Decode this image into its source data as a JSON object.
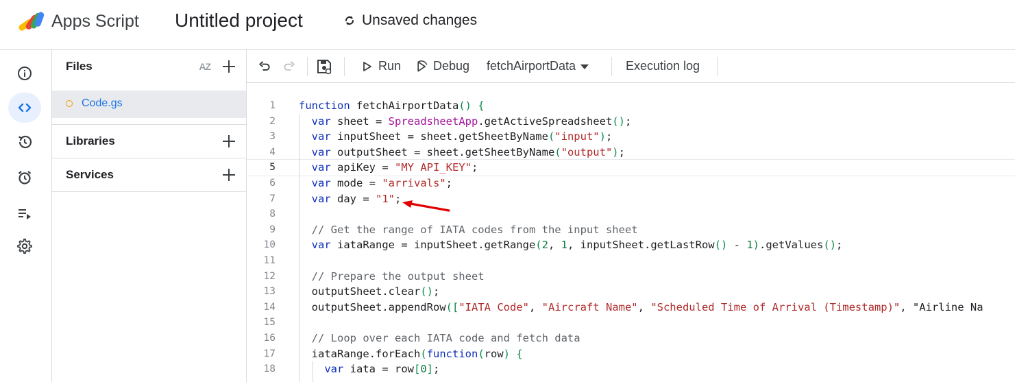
{
  "header": {
    "app_name": "Apps Script",
    "project_title": "Untitled project",
    "status": "Unsaved changes"
  },
  "rail": {
    "items": [
      {
        "name": "overview",
        "icon": "info-icon"
      },
      {
        "name": "editor",
        "icon": "code-icon",
        "active": true
      },
      {
        "name": "triggers-history",
        "icon": "history-icon"
      },
      {
        "name": "triggers",
        "icon": "alarm-icon"
      },
      {
        "name": "executions",
        "icon": "executions-icon"
      },
      {
        "name": "settings",
        "icon": "gear-icon"
      }
    ]
  },
  "files_panel": {
    "files_label": "Files",
    "sort_label": "AZ",
    "file_name": "Code.gs",
    "libraries_label": "Libraries",
    "services_label": "Services"
  },
  "toolbar": {
    "run_label": "Run",
    "debug_label": "Debug",
    "function_select": "fetchAirportData",
    "execution_log_label": "Execution log"
  },
  "editor": {
    "current_line": 5,
    "lines": [
      {
        "n": "1",
        "text": "function fetchAirportData() {"
      },
      {
        "n": "2",
        "text": "  var sheet = SpreadsheetApp.getActiveSpreadsheet();"
      },
      {
        "n": "3",
        "text": "  var inputSheet = sheet.getSheetByName(\"input\");"
      },
      {
        "n": "4",
        "text": "  var outputSheet = sheet.getSheetByName(\"output\");"
      },
      {
        "n": "5",
        "text": "  var apiKey = \"MY API_KEY\";"
      },
      {
        "n": "6",
        "text": "  var mode = \"arrivals\";"
      },
      {
        "n": "7",
        "text": "  var day = \"1\";"
      },
      {
        "n": "8",
        "text": ""
      },
      {
        "n": "9",
        "text": "  // Get the range of IATA codes from the input sheet"
      },
      {
        "n": "10",
        "text": "  var iataRange = inputSheet.getRange(2, 1, inputSheet.getLastRow() - 1).getValues();"
      },
      {
        "n": "11",
        "text": ""
      },
      {
        "n": "12",
        "text": "  // Prepare the output sheet"
      },
      {
        "n": "13",
        "text": "  outputSheet.clear();"
      },
      {
        "n": "14",
        "text": "  outputSheet.appendRow([\"IATA Code\", \"Aircraft Name\", \"Scheduled Time of Arrival (Timestamp)\", \"Airline Na"
      },
      {
        "n": "15",
        "text": ""
      },
      {
        "n": "16",
        "text": "  // Loop over each IATA code and fetch data"
      },
      {
        "n": "17",
        "text": "  iataRange.forEach(function(row) {"
      },
      {
        "n": "18",
        "text": "    var iata = row[0];"
      }
    ]
  },
  "colors": {
    "accent": "#1a73e8",
    "keyword": "#0b2eb8",
    "string": "#b02a2a",
    "comment": "#5f6368",
    "arrow": "#e00000"
  }
}
